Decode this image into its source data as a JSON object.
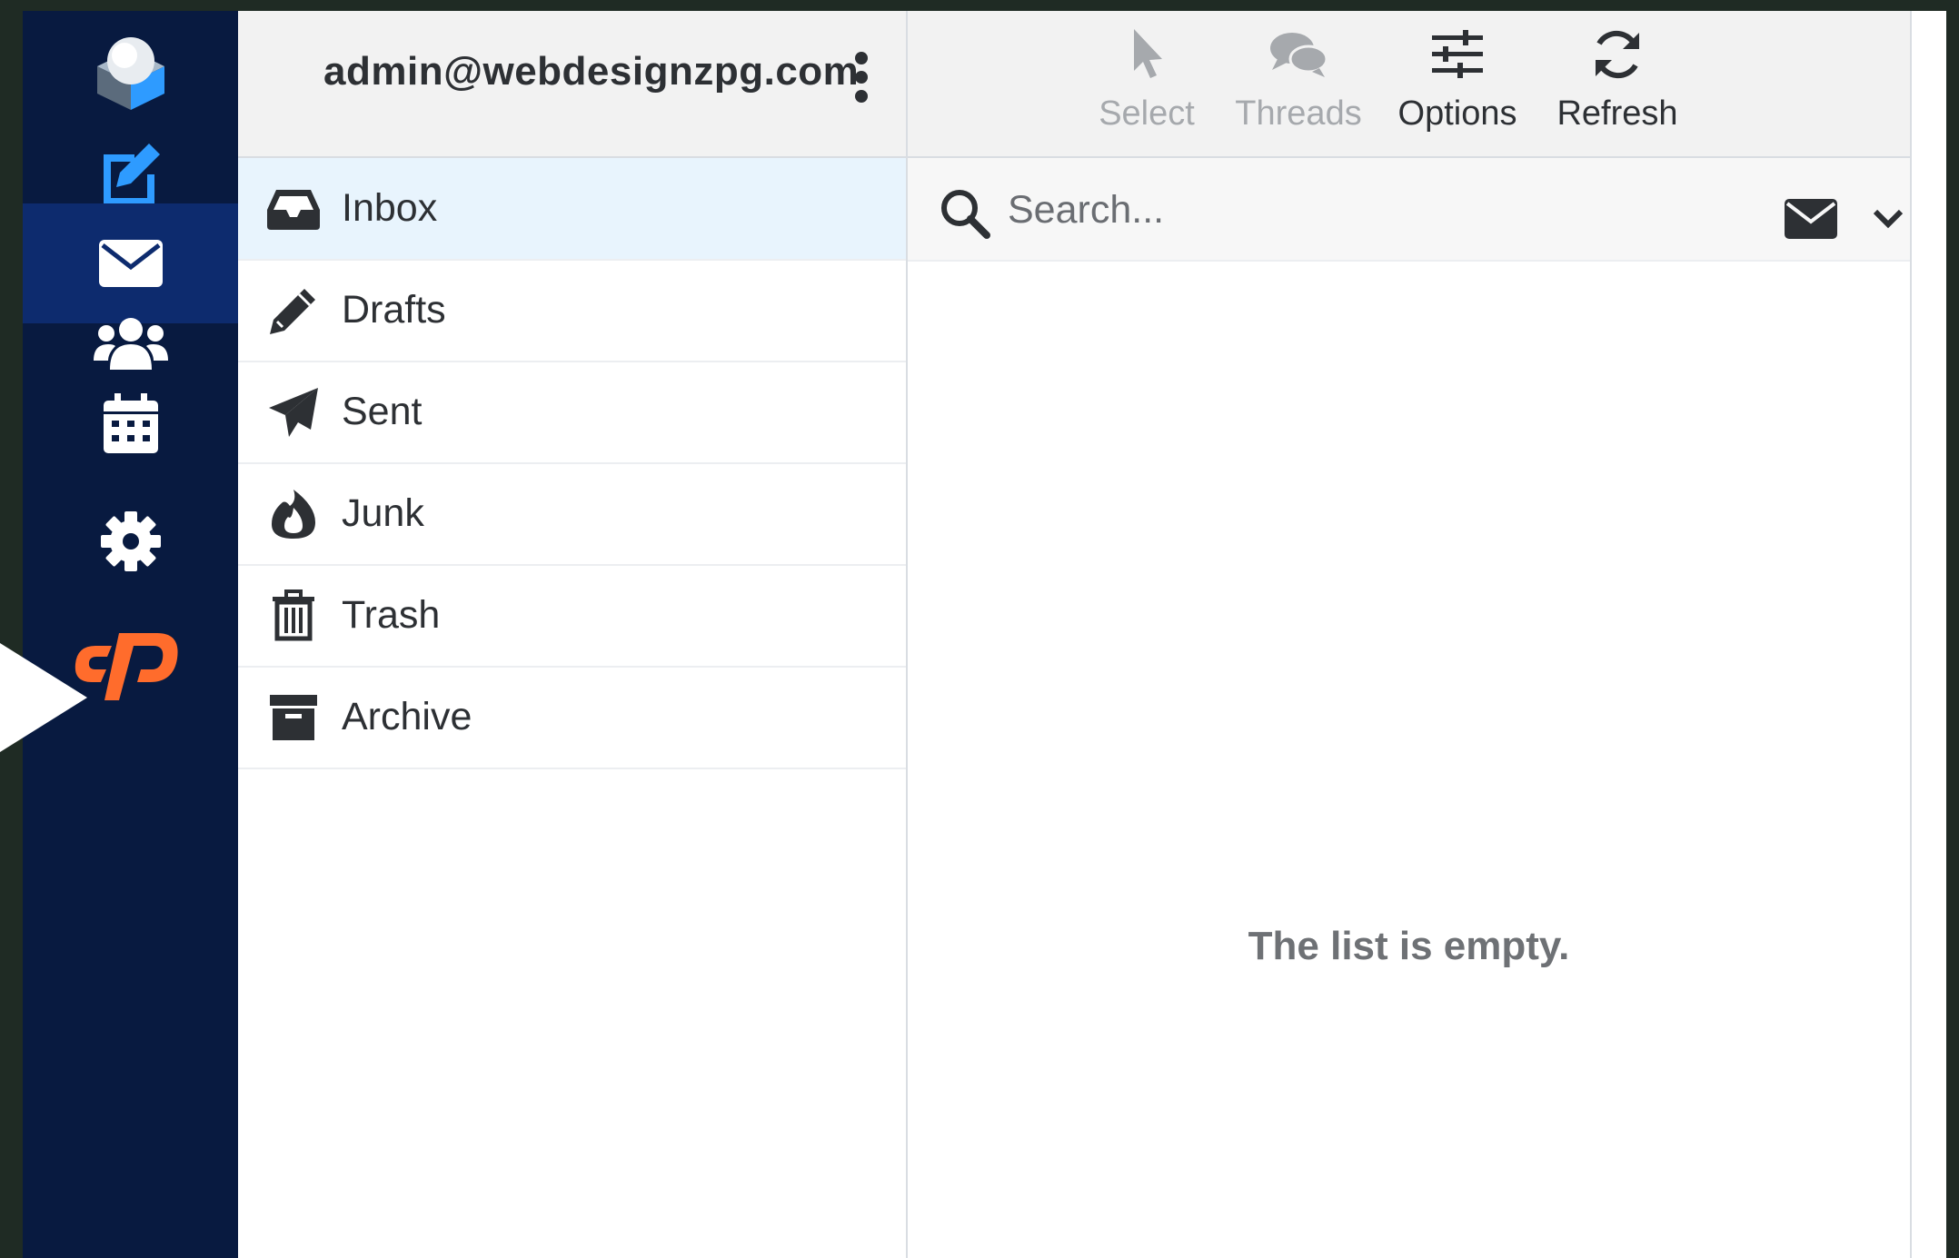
{
  "account": {
    "email": "admin@webdesignzpg.com"
  },
  "rail": {
    "items": [
      {
        "icon": "compose-icon"
      },
      {
        "icon": "mail-icon",
        "active": true
      },
      {
        "icon": "contacts-icon"
      },
      {
        "icon": "calendar-icon"
      },
      {
        "icon": "settings-icon"
      },
      {
        "icon": "cpanel-icon"
      }
    ]
  },
  "folders": [
    {
      "label": "Inbox",
      "icon": "inbox-icon",
      "selected": true
    },
    {
      "label": "Drafts",
      "icon": "pencil-icon"
    },
    {
      "label": "Sent",
      "icon": "paper-plane-icon"
    },
    {
      "label": "Junk",
      "icon": "fire-icon"
    },
    {
      "label": "Trash",
      "icon": "trash-icon"
    },
    {
      "label": "Archive",
      "icon": "archive-icon"
    }
  ],
  "toolbar": {
    "select_label": "Select",
    "threads_label": "Threads",
    "options_label": "Options",
    "refresh_label": "Refresh"
  },
  "search": {
    "placeholder": "Search..."
  },
  "message_list": {
    "empty_text": "The list is empty."
  },
  "colors": {
    "rail_bg": "#081a40",
    "rail_active": "#0d2b6e",
    "accent_blue": "#2e9bff",
    "cpanel_orange": "#ff6c2c",
    "selected_folder": "#e8f4fd"
  }
}
